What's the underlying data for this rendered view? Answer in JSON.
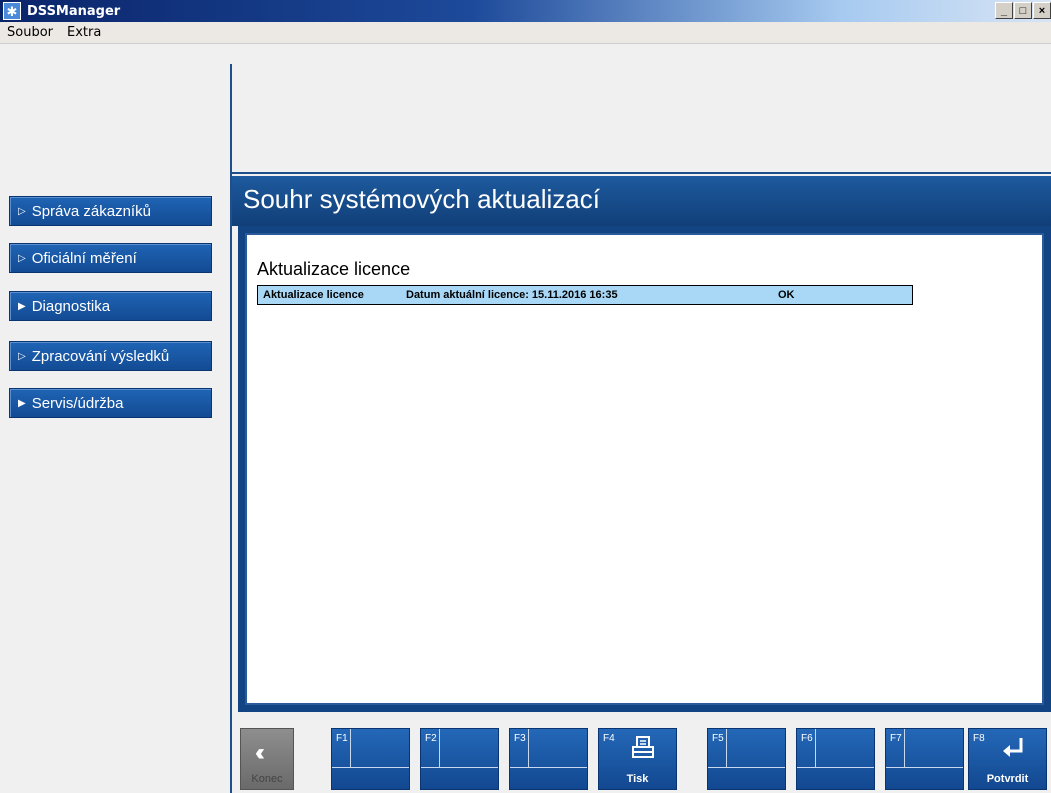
{
  "window": {
    "title": "DSSManager",
    "controls": [
      "_",
      "□",
      "×"
    ]
  },
  "menu": [
    "Soubor",
    "Extra"
  ],
  "sidebar": {
    "items": [
      {
        "label": "Správa zákazníků",
        "icon": "play-outline-icon"
      },
      {
        "label": "Oficiální měření",
        "icon": "play-outline-icon"
      },
      {
        "label": "Diagnostika",
        "icon": "play-filled-icon"
      },
      {
        "label": "Zpracování výsledků",
        "icon": "play-outline-icon"
      },
      {
        "label": "Servis/údržba",
        "icon": "play-filled-icon"
      }
    ]
  },
  "header": {
    "title": "Souhr systémových aktualizací"
  },
  "main": {
    "section_title": "Aktualizace licence",
    "rows": [
      {
        "name": "Aktualizace licence",
        "detail": "Datum aktuální licence: 15.11.2016 16:35",
        "status": "OK"
      }
    ]
  },
  "toolbar": {
    "back": {
      "label": "Konec",
      "icon": "double-chevron-left-icon"
    },
    "keys": [
      {
        "key": "F1",
        "label": ""
      },
      {
        "key": "F2",
        "label": ""
      },
      {
        "key": "F3",
        "label": ""
      },
      {
        "key": "F4",
        "label": "Tisk",
        "icon": "printer-icon"
      },
      {
        "key": "F5",
        "label": ""
      },
      {
        "key": "F6",
        "label": ""
      },
      {
        "key": "F7",
        "label": ""
      },
      {
        "key": "F8",
        "label": "Potvrdit",
        "icon": "enter-arrow-icon"
      }
    ]
  },
  "colors": {
    "nav_blue": "#1a58a6",
    "header_blue": "#174c8c",
    "row_highlight": "#a8d8f6"
  }
}
